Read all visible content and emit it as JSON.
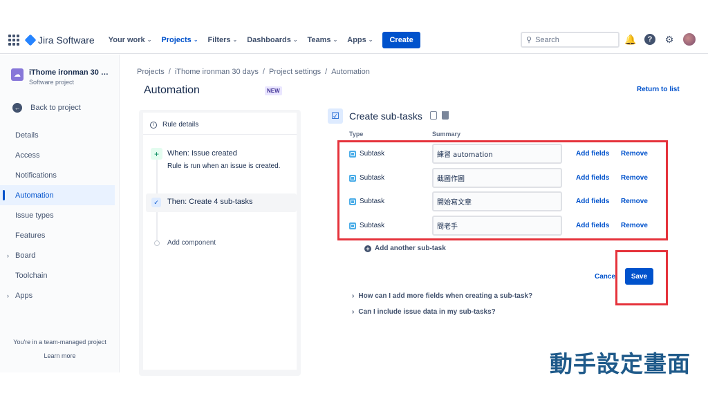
{
  "nav": {
    "logo": "Jira Software",
    "items": [
      {
        "label": "Your work",
        "active": false
      },
      {
        "label": "Projects",
        "active": true
      },
      {
        "label": "Filters",
        "active": false
      },
      {
        "label": "Dashboards",
        "active": false
      },
      {
        "label": "Teams",
        "active": false
      },
      {
        "label": "Apps",
        "active": false
      }
    ],
    "create": "Create",
    "search_placeholder": "Search"
  },
  "sidebar": {
    "project_name": "iThome ironman 30 da...",
    "project_type": "Software project",
    "back": "Back to project",
    "items": [
      {
        "label": "Details"
      },
      {
        "label": "Access"
      },
      {
        "label": "Notifications"
      },
      {
        "label": "Automation"
      },
      {
        "label": "Issue types"
      },
      {
        "label": "Features"
      },
      {
        "label": "Board"
      },
      {
        "label": "Toolchain"
      },
      {
        "label": "Apps"
      }
    ],
    "footer_text": "You're in a team-managed project",
    "footer_link": "Learn more"
  },
  "breadcrumb": [
    "Projects",
    "/",
    "iThome ironman 30 days",
    "/",
    "Project settings",
    "/",
    "Automation"
  ],
  "page": {
    "title": "Automation",
    "badge": "NEW",
    "return_link": "Return to list"
  },
  "rule": {
    "details": "Rule details",
    "when_title": "When: Issue created",
    "when_desc": "Rule is run when an issue is created.",
    "then_title": "Then: Create 4 sub-tasks",
    "add_component": "Add component"
  },
  "component": {
    "title": "Create sub-tasks",
    "col_type": "Type",
    "col_summary": "Summary",
    "rows": [
      {
        "type": "Subtask",
        "summary": "練習 automation",
        "add_fields": "Add fields",
        "remove": "Remove"
      },
      {
        "type": "Subtask",
        "summary": "截圖作圖",
        "add_fields": "Add fields",
        "remove": "Remove"
      },
      {
        "type": "Subtask",
        "summary": "開始寫文章",
        "add_fields": "Add fields",
        "remove": "Remove"
      },
      {
        "type": "Subtask",
        "summary": "問老手",
        "add_fields": "Add fields",
        "remove": "Remove"
      }
    ],
    "add_another": "Add another sub-task",
    "cancel": "Cance",
    "save": "Save",
    "faq": [
      "How can I add more fields when creating a sub-task?",
      "Can I include issue data in my sub-tasks?"
    ]
  },
  "caption": "動手設定畫面",
  "colors": {
    "accent": "#0052cc",
    "highlight": "#e5323b"
  }
}
